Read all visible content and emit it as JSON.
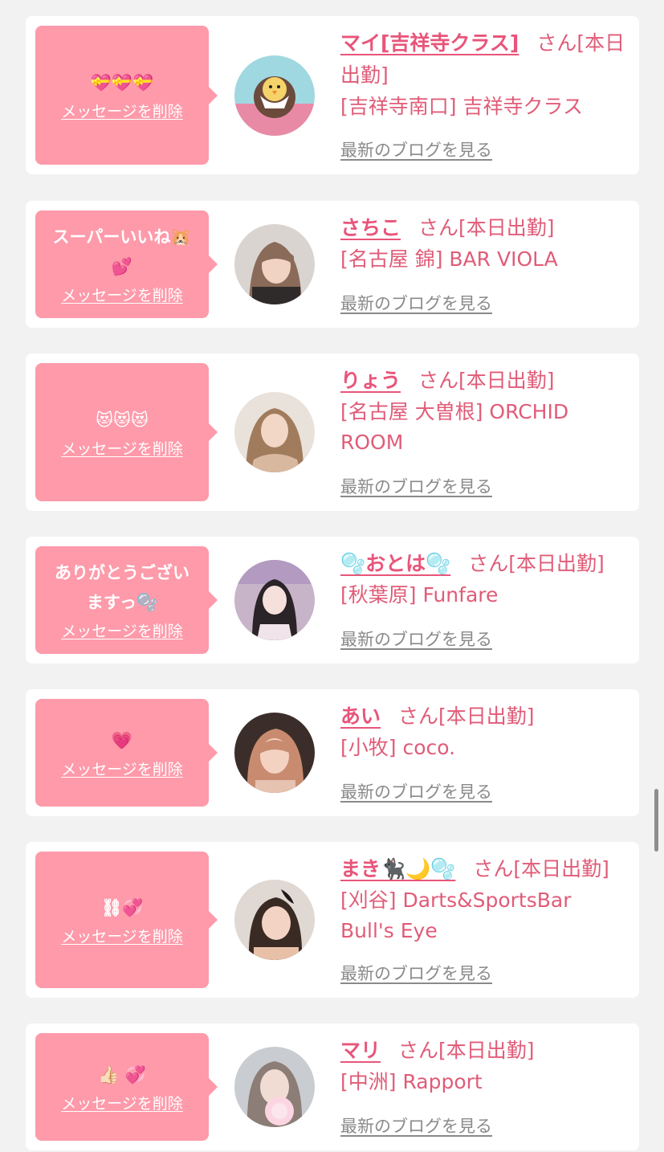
{
  "common": {
    "delete_label": "メッセージを削除",
    "blog_label": "最新のブログを見る"
  },
  "items": [
    {
      "message": "💝💝💝",
      "name": "マイ[吉祥寺クラス]",
      "status": "さん[本日出勤]",
      "shop": "[吉祥寺南口] 吉祥寺クラス",
      "avatar_icon": "chick-emoji-avatar",
      "avatar_colors": [
        "#9fd8e0",
        "#e88aa6",
        "#f5d36a"
      ]
    },
    {
      "message": "スーパーいいね🐹\n💕",
      "name": "さちこ",
      "status": "さん[本日出勤]",
      "shop": "[名古屋 錦] BAR VIOLA",
      "avatar_icon": "person-avatar",
      "avatar_colors": [
        "#d9d4d0",
        "#8a6a58",
        "#2f2b2b"
      ]
    },
    {
      "message": "😻😻😻",
      "name": "りょう",
      "status": "さん[本日出勤]",
      "shop": "[名古屋 大曽根] ORCHID ROOM",
      "avatar_icon": "person-avatar",
      "avatar_colors": [
        "#e9e2da",
        "#a07c5c",
        "#d9b8a0"
      ]
    },
    {
      "message": "ありがとうござい\nますっ🫧",
      "name": "🫧おとは🫧",
      "status": "さん[本日出勤]",
      "shop": "[秋葉原] Funfare",
      "avatar_icon": "person-avatar",
      "avatar_colors": [
        "#c7b4c8",
        "#2a2428",
        "#f0e4ea"
      ]
    },
    {
      "message": "💗",
      "name": "あい",
      "status": "さん[本日出勤]",
      "shop": "[小牧] coco.",
      "avatar_icon": "person-avatar",
      "avatar_colors": [
        "#3b2e2a",
        "#c98b6f",
        "#e6c2b0"
      ]
    },
    {
      "message": "⛓💞",
      "name": "まき🐈‍⬛🌙🫧",
      "status": "さん[本日出勤]",
      "shop": "[刈谷] Darts&SportsBar Bull's Eye",
      "avatar_icon": "person-avatar",
      "avatar_colors": [
        "#e0d8d2",
        "#1e1a1a",
        "#e8c0a8"
      ]
    },
    {
      "message": "👍🏻 💞",
      "name": "マリ",
      "status": "さん[本日出勤]",
      "shop": "[中洲] Rapport",
      "avatar_icon": "person-avatar",
      "avatar_colors": [
        "#c9ccd0",
        "#8c7d76",
        "#fbd6e2"
      ]
    }
  ]
}
